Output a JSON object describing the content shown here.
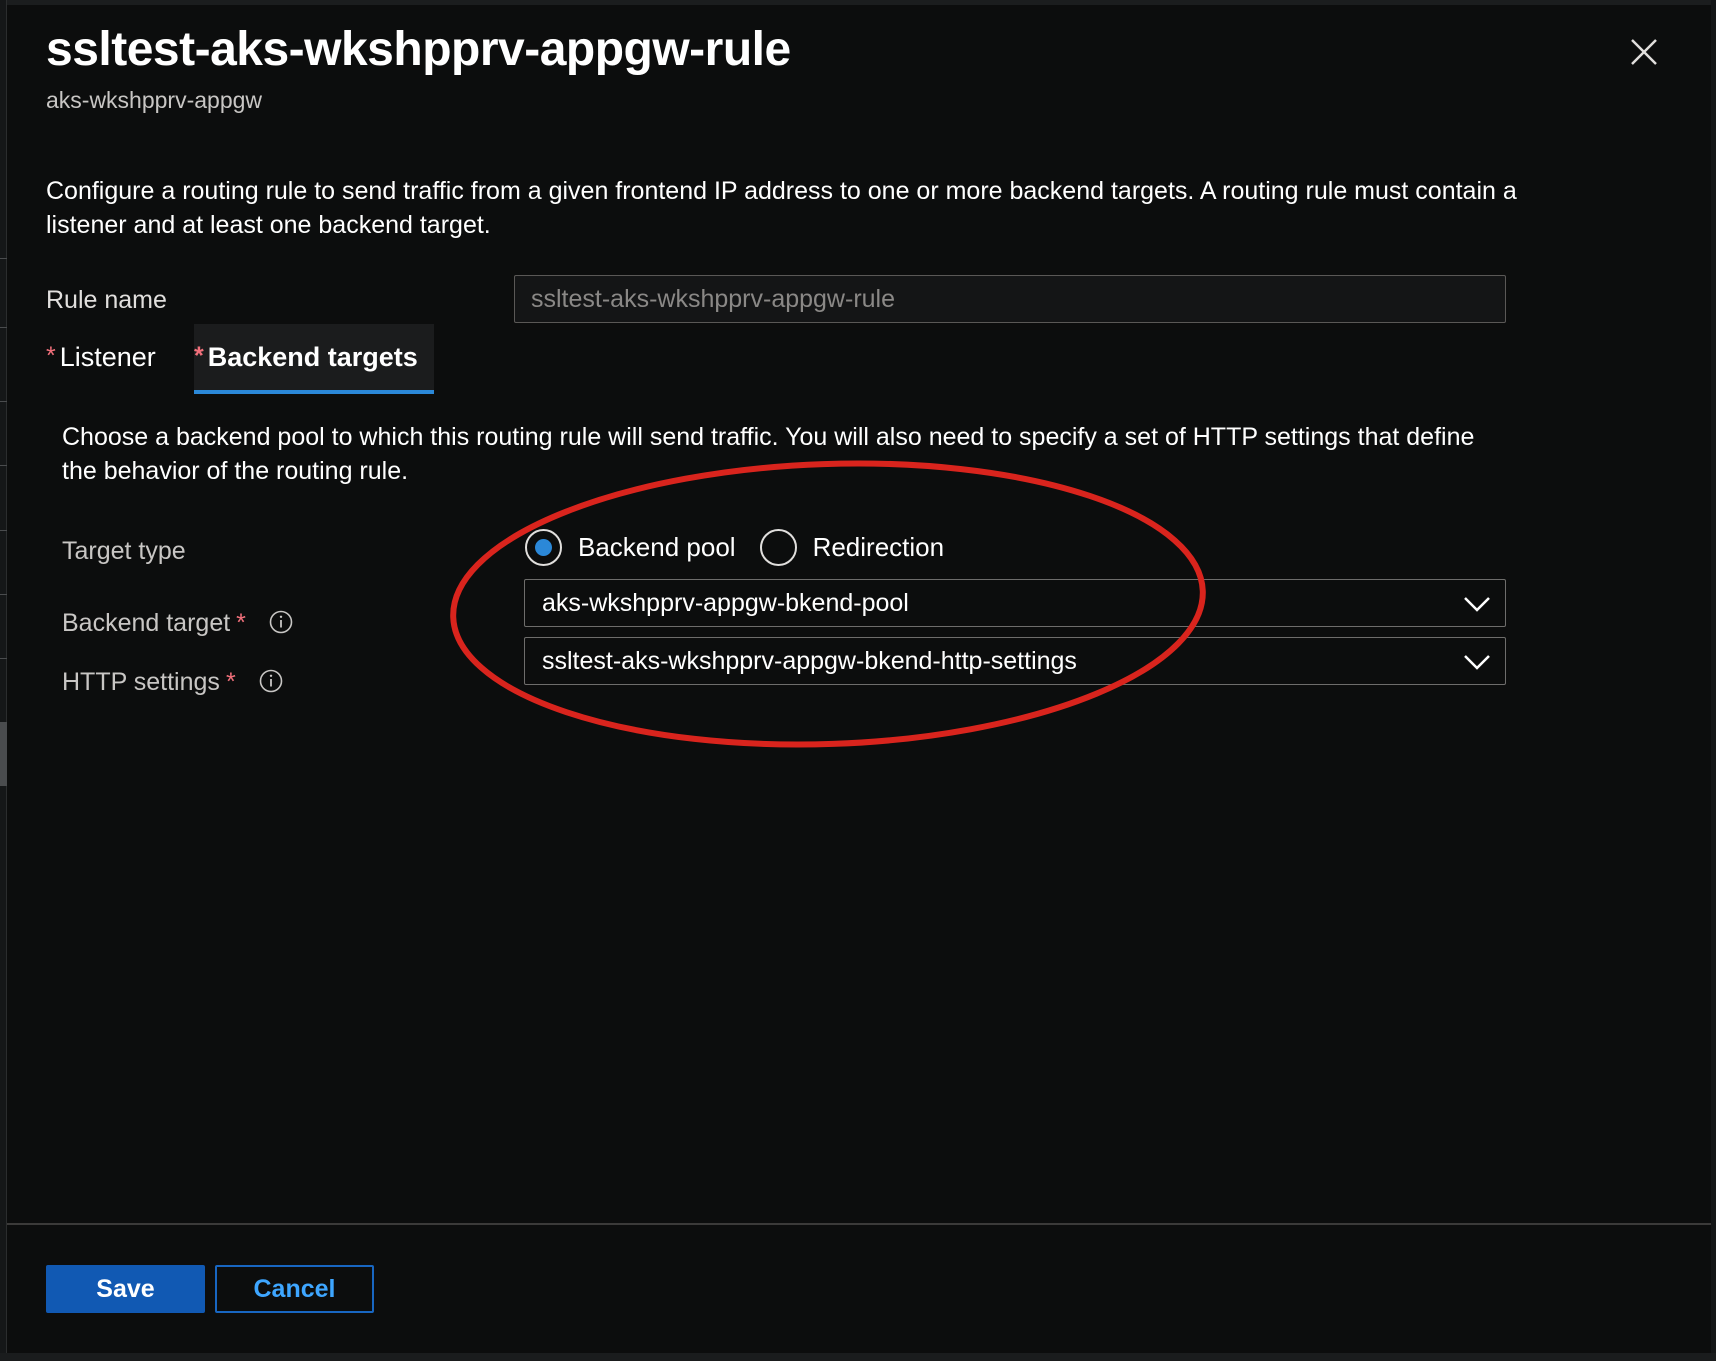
{
  "header": {
    "title": "ssltest-aks-wkshpprv-appgw-rule",
    "subtitle": "aks-wkshpprv-appgw",
    "close_icon": "close-icon"
  },
  "description": "Configure a routing rule to send traffic from a given frontend IP address to one or more backend targets. A routing rule must contain a listener and at least one backend target.",
  "rule_name": {
    "label": "Rule name",
    "value": "ssltest-aks-wkshpprv-appgw-rule"
  },
  "tabs": [
    {
      "label": "Listener",
      "required_marker": "*",
      "selected": false
    },
    {
      "label": "Backend targets",
      "required_marker": "*",
      "selected": true
    }
  ],
  "backend_tab": {
    "description": "Choose a backend pool to which this routing rule will send traffic. You will also need to specify a set of HTTP settings that define the behavior of the routing rule.",
    "target_type": {
      "label": "Target type",
      "options": [
        "Backend pool",
        "Redirection"
      ],
      "selected": "Backend pool"
    },
    "backend_target": {
      "label": "Backend target",
      "required_marker": "*",
      "value": "aks-wkshpprv-appgw-bkend-pool"
    },
    "http_settings": {
      "label": "HTTP settings",
      "required_marker": "*",
      "value": "ssltest-aks-wkshpprv-appgw-bkend-http-settings"
    }
  },
  "footer": {
    "save_label": "Save",
    "cancel_label": "Cancel"
  },
  "colors": {
    "background": "#0c0d0d",
    "accent": "#2b88d8",
    "primary_button": "#1159b3",
    "required": "#f1707b",
    "annotation": "#d9241d"
  }
}
